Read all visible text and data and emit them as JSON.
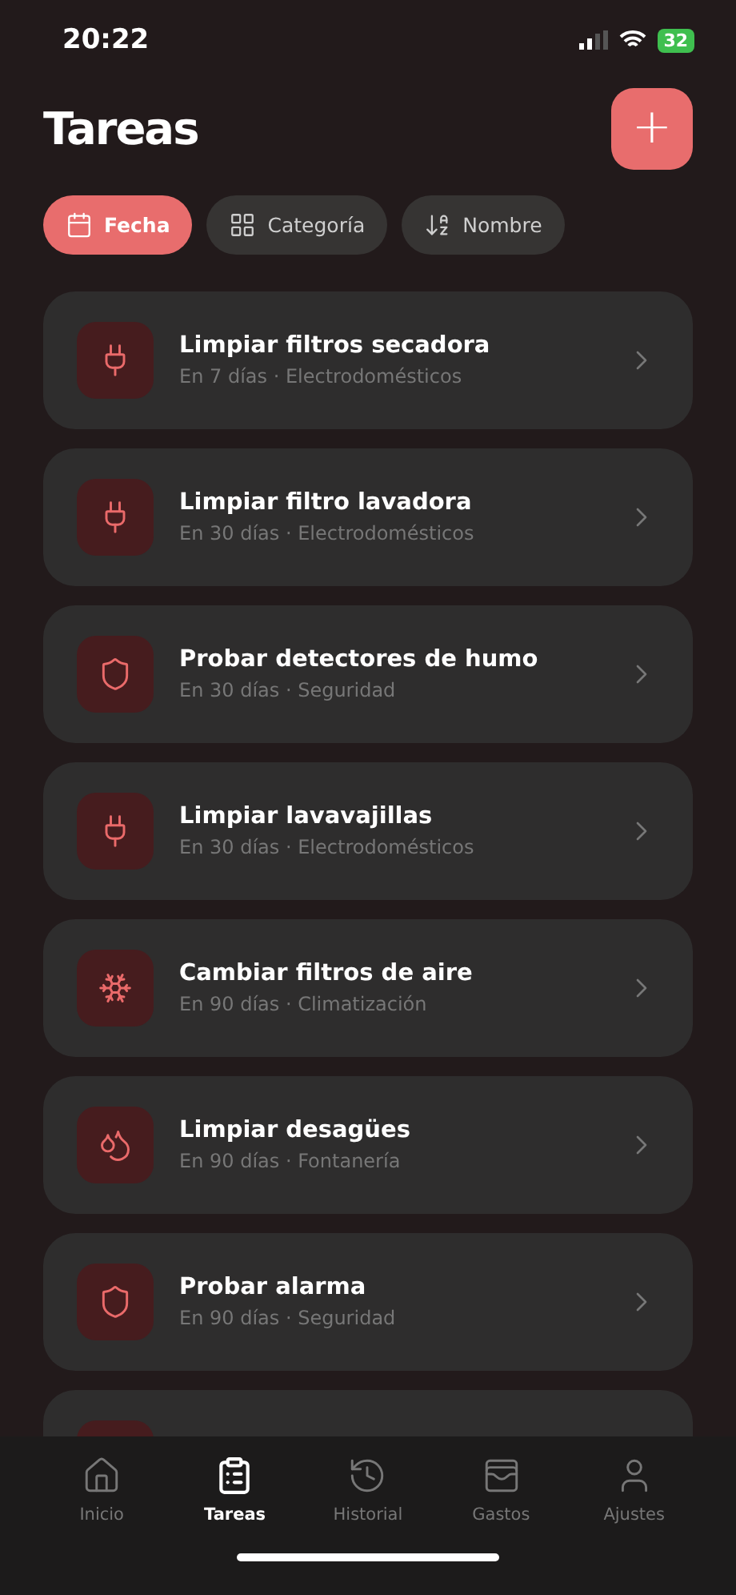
{
  "status_bar": {
    "time": "20:22",
    "battery": "32"
  },
  "header": {
    "title": "Tareas",
    "add_button": "+"
  },
  "sort_chips": [
    {
      "label": "Fecha",
      "kind": "date",
      "selected": true
    },
    {
      "label": "Categoría",
      "kind": "category",
      "selected": false
    },
    {
      "label": "Nombre",
      "kind": "name",
      "selected": false
    }
  ],
  "tasks": [
    {
      "title": "Limpiar filtros secadora",
      "meta": "En 7 días · Electrodomésticos",
      "kind": "appliance"
    },
    {
      "title": "Limpiar filtro lavadora",
      "meta": "En 30 días · Electrodomésticos",
      "kind": "appliance"
    },
    {
      "title": "Probar detectores de humo",
      "meta": "En 30 días · Seguridad",
      "kind": "safety"
    },
    {
      "title": "Limpiar lavavajillas",
      "meta": "En 30 días · Electrodomésticos",
      "kind": "appliance"
    },
    {
      "title": "Cambiar filtros de aire",
      "meta": "En 90 días · Climatización",
      "kind": "climate"
    },
    {
      "title": "Limpiar desagües",
      "meta": "En 90 días · Fontanería",
      "kind": "plumbing"
    },
    {
      "title": "Probar alarma",
      "meta": "En 90 días · Seguridad",
      "kind": "safety"
    },
    {
      "kind": "partial"
    }
  ],
  "tab_bar": [
    {
      "label": "Inicio",
      "kind": "home",
      "selected": false
    },
    {
      "label": "Tareas",
      "kind": "tasks",
      "selected": true
    },
    {
      "label": "Historial",
      "kind": "history",
      "selected": false
    },
    {
      "label": "Gastos",
      "kind": "expenses",
      "selected": false
    },
    {
      "label": "Ajustes",
      "kind": "settings",
      "selected": false
    }
  ]
}
